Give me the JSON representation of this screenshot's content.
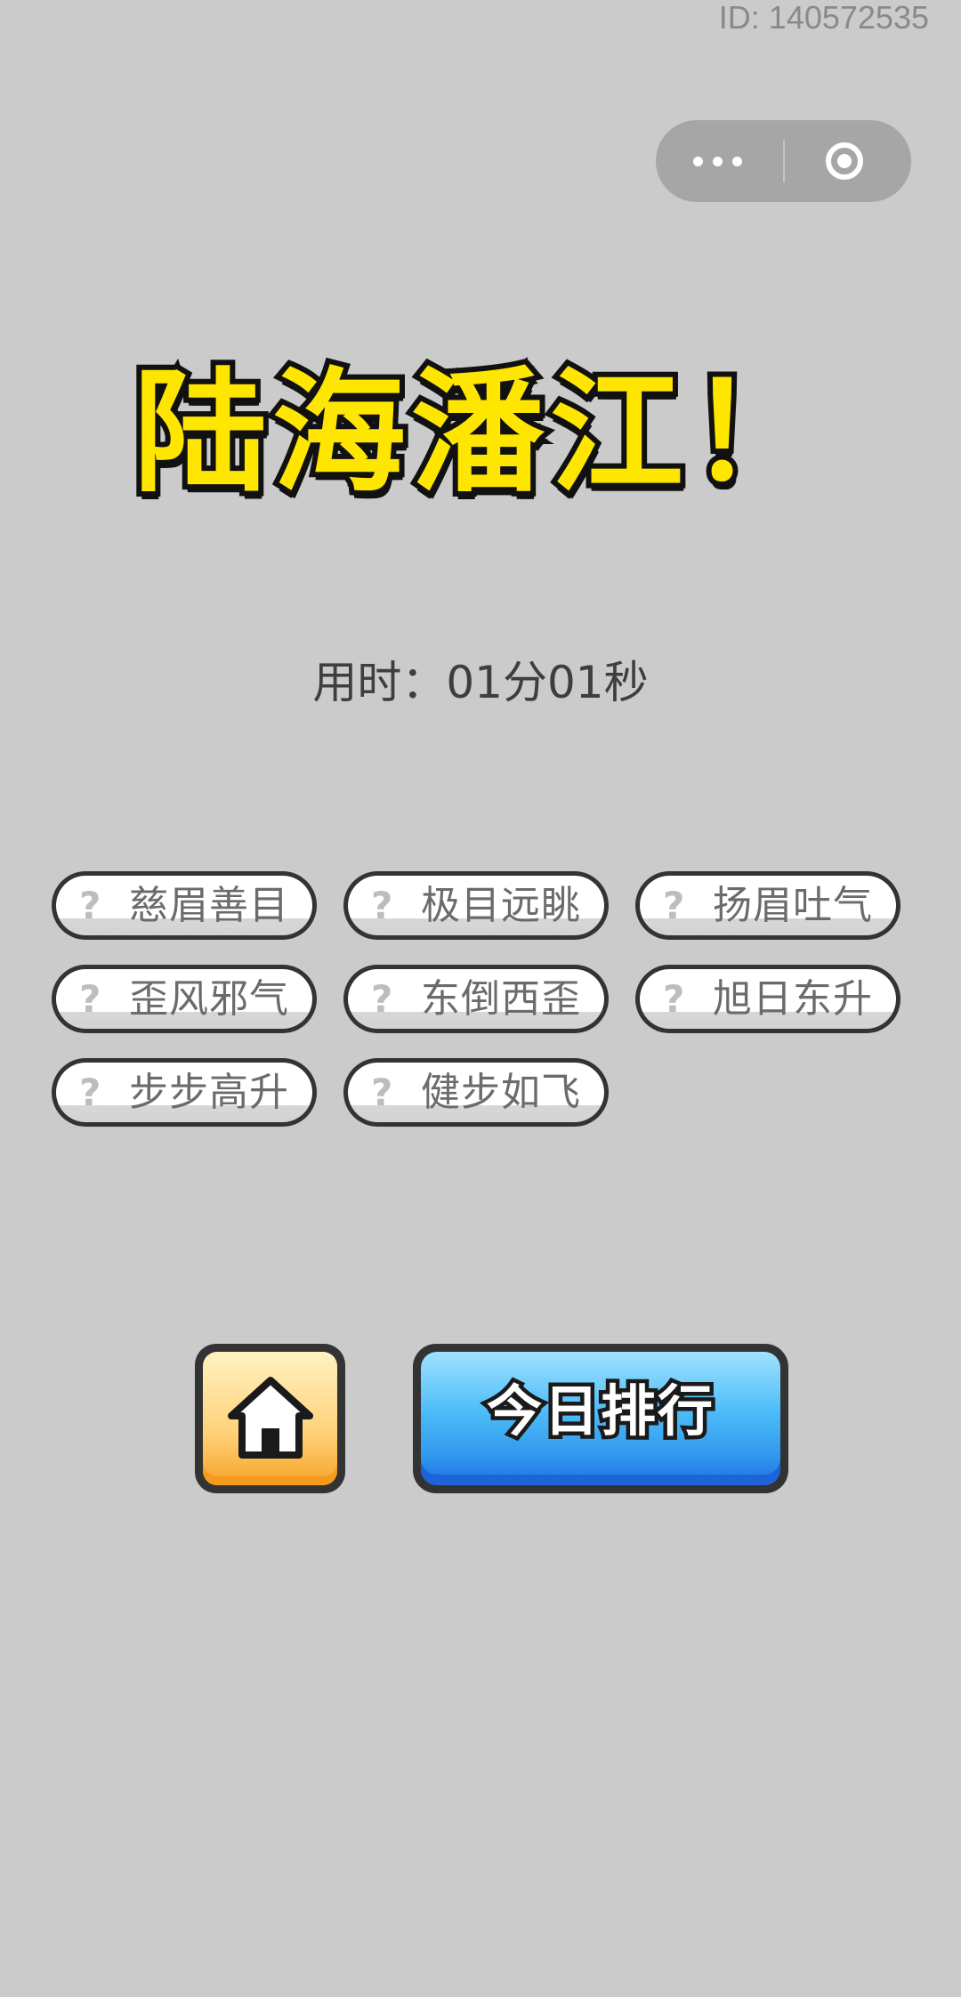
{
  "header": {
    "id_text": "ID: 140572535"
  },
  "capsule": {
    "more_icon": "more-dots-icon",
    "close_icon": "target-circle-icon"
  },
  "title": {
    "chars": [
      "陆",
      "海",
      "潘",
      "江",
      "！"
    ]
  },
  "timer": {
    "text": "用时：01分01秒"
  },
  "answers": [
    {
      "hint": "?",
      "text": "慈眉善目"
    },
    {
      "hint": "?",
      "text": "极目远眺"
    },
    {
      "hint": "?",
      "text": "扬眉吐气"
    },
    {
      "hint": "?",
      "text": "歪风邪气"
    },
    {
      "hint": "?",
      "text": "东倒西歪"
    },
    {
      "hint": "?",
      "text": "旭日东升"
    },
    {
      "hint": "?",
      "text": "步步高升"
    },
    {
      "hint": "?",
      "text": "健步如飞"
    }
  ],
  "buttons": {
    "home_icon": "home-icon",
    "rank_label": "今日排行"
  },
  "colors": {
    "background": "#cbcbcb",
    "title_fill": "#ffe600",
    "rank_button": "#2f95ee",
    "home_button": "#ffd27a"
  }
}
